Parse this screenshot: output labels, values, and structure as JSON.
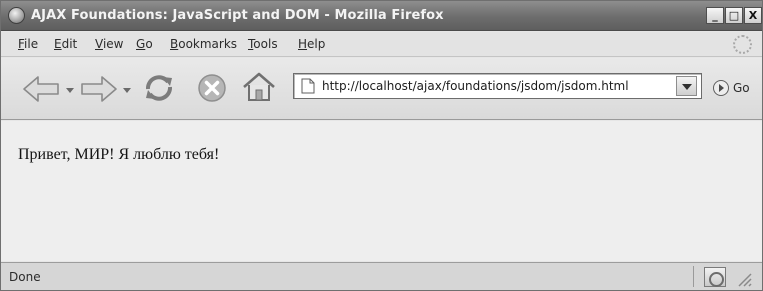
{
  "window": {
    "title": "AJAX Foundations: JavaScript and DOM - Mozilla Firefox",
    "minimize_label": "_",
    "maximize_label": "□",
    "close_label": "X"
  },
  "menu": {
    "file": {
      "mnemonic": "F",
      "rest": "ile"
    },
    "edit": {
      "mnemonic": "E",
      "rest": "dit"
    },
    "view": {
      "mnemonic": "V",
      "rest": "iew"
    },
    "go": {
      "mnemonic": "G",
      "rest": "o"
    },
    "bookmarks": {
      "mnemonic": "B",
      "rest": "ookmarks"
    },
    "tools": {
      "mnemonic": "T",
      "rest": "ools"
    },
    "help": {
      "mnemonic": "H",
      "rest": "elp"
    }
  },
  "toolbar": {
    "address": "http://localhost/ajax/foundations/jsdom/jsdom.html",
    "go_label": "Go"
  },
  "page": {
    "text": "Привет, МИР! Я люблю тебя!"
  },
  "status": {
    "text": "Done"
  }
}
